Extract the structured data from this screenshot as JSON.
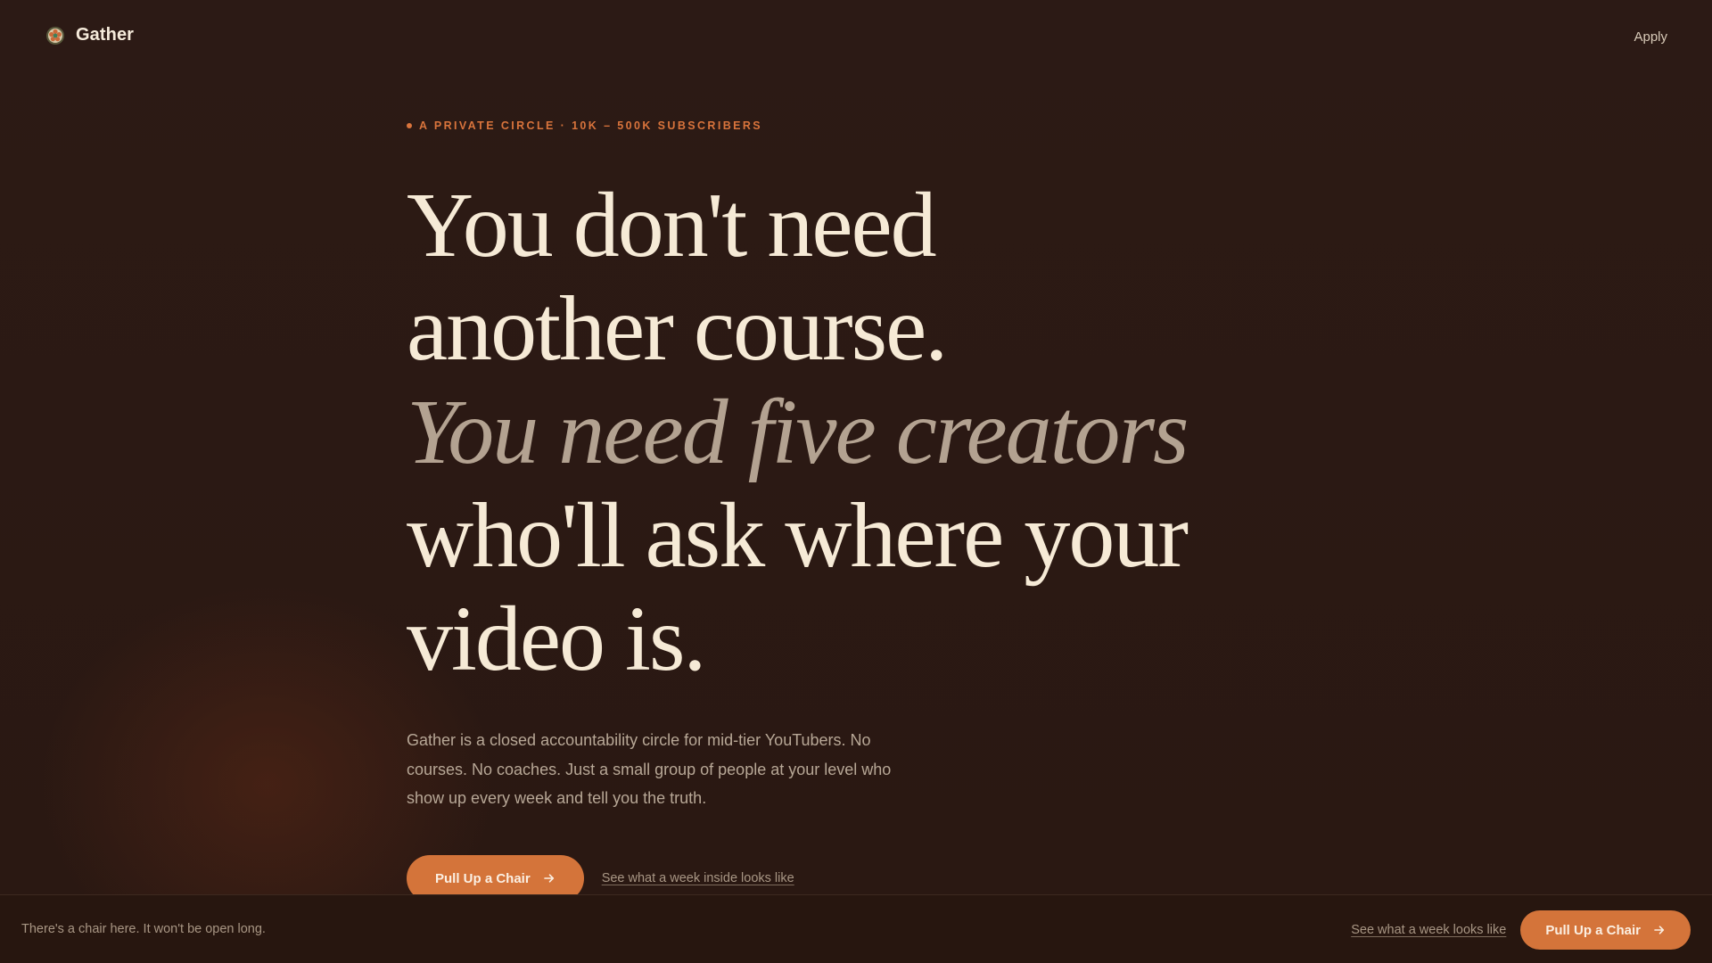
{
  "nav": {
    "brand_name": "Gather",
    "logo_icon": "flower-badge-icon",
    "apply_label": "Apply"
  },
  "hero": {
    "eyebrow": "A PRIVATE CIRCLE · 10K – 500K SUBSCRIBERS",
    "headline_lines": [
      "You don't need",
      "another course.",
      "You need five creators",
      "who'll ask where your",
      "video is."
    ],
    "lede": "Gather is a closed accountability circle for mid-tier YouTubers. No courses. No coaches. Just a small group of people at your level who show up every week and tell you the truth.",
    "cta_primary": "Pull Up a Chair",
    "cta_secondary": "See what a week inside looks like"
  },
  "sticky_bar": {
    "message": "There's a chair here. It won't be open long.",
    "link_label": "See what a week looks like",
    "cta_label": "Pull Up a Chair"
  },
  "colors": {
    "background": "#2b1914",
    "accent": "#d4743a",
    "text_primary": "#f6ead6",
    "text_muted": "#b3a291"
  }
}
